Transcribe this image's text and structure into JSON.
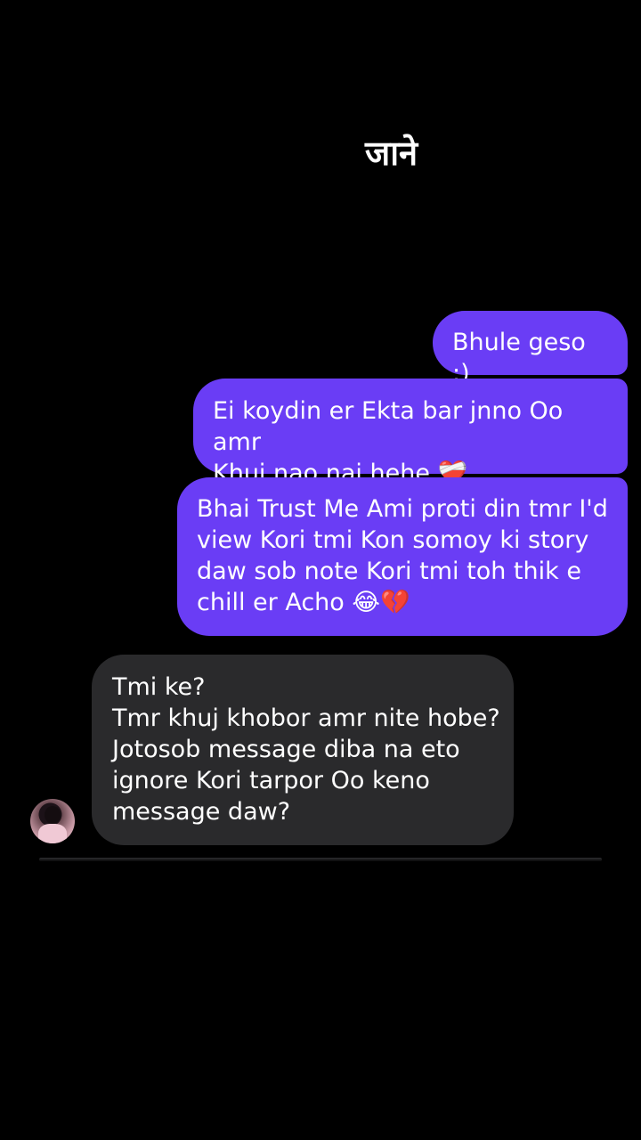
{
  "header": {
    "title": "जाने"
  },
  "messages": [
    {
      "direction": "sent",
      "text": "Bhule geso :)"
    },
    {
      "direction": "sent",
      "text": "Ei koydin er Ekta bar jnno Oo amr\nKhuj nao nai hehe ❤️‍🩹"
    },
    {
      "direction": "sent",
      "text": "Bhai Trust Me Ami proti din tmr I'd\nview Kori tmi Kon somoy ki story\ndaw sob note Kori tmi toh thik e\nchill er Acho 😂💔"
    },
    {
      "direction": "received",
      "text": "Tmi ke?\nTmr khuj khobor amr nite hobe?\nJotosob message diba na eto\nignore Kori tarpor Oo keno\nmessage daw?"
    }
  ],
  "colors": {
    "background": "#000000",
    "sent_bubble": "#6a3df5",
    "received_bubble": "#2a2a2c",
    "text": "#ffffff"
  }
}
